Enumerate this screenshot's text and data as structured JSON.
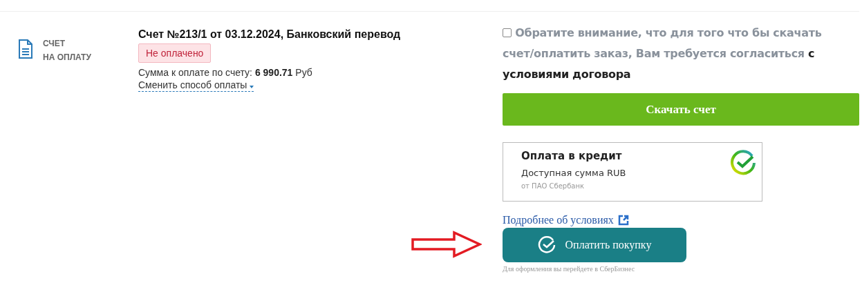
{
  "document": {
    "label_line_1": "СЧЕТ",
    "label_line_2": "НА ОПЛАТУ"
  },
  "invoice": {
    "title": "Счет №213/1 от 03.12.2024, Банковский перевод",
    "status": "Не оплачено",
    "paid": false,
    "amount_label": "Сумма к оплате по счету:",
    "amount": "6 990.71",
    "currency": "Руб",
    "change_method": "Сменить способ оплаты"
  },
  "agreement": {
    "checked": false,
    "notice": "Обратите внимание, что для того что бы скачать счет/оплатить заказ, Вам требуется согласиться",
    "terms": "с условиями договора"
  },
  "download_button": "Скачать счет",
  "credit_card": {
    "title": "Оплата в кредит",
    "subtitle": "Доступная сумма RUB",
    "provider": "от ПАО Сбербанк"
  },
  "details_link": "Подробнее об условиях",
  "pay_button": "Оплатить покупку",
  "pay_hint": "Для оформления вы перейдете в СберБизнес"
}
